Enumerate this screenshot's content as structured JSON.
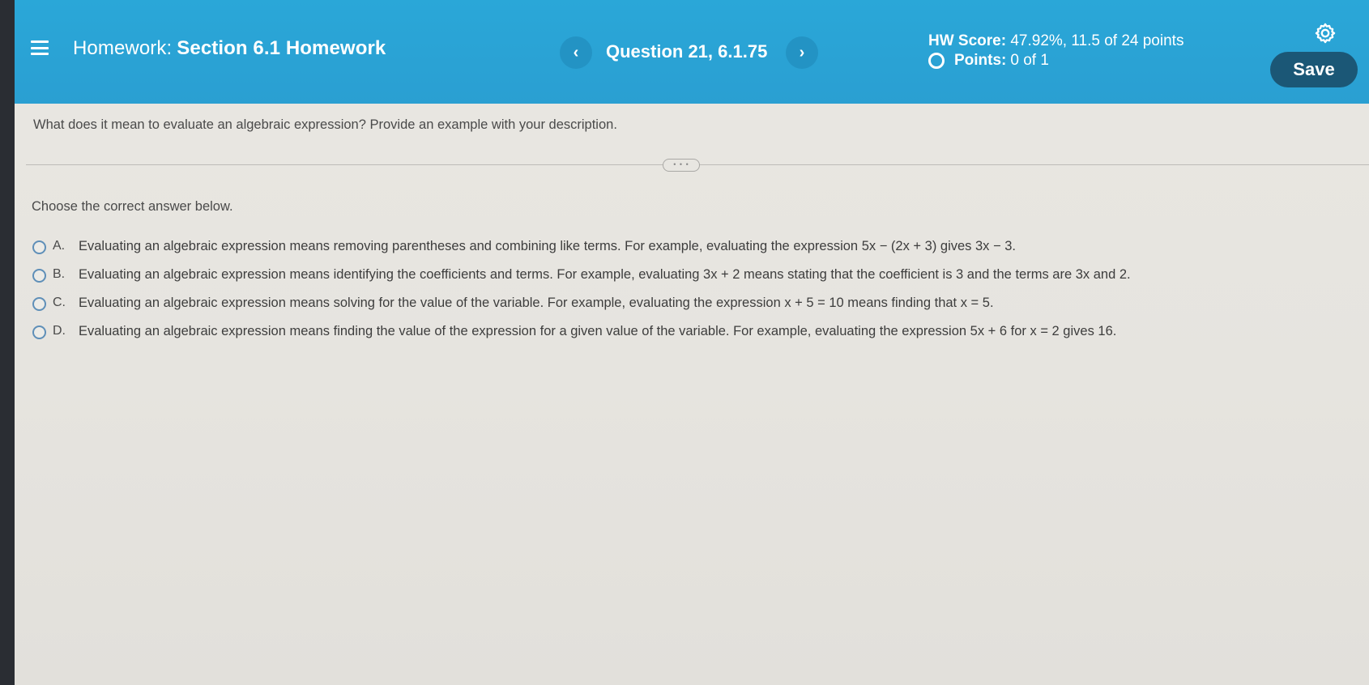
{
  "header": {
    "title_prefix": "Homework:",
    "title_name": "Section 6.1 Homework",
    "prev_label": "‹",
    "next_label": "›",
    "question_label": "Question 21, 6.1.75",
    "hw_score_label": "HW Score:",
    "hw_score_value": "47.92%, 11.5 of 24 points",
    "points_label": "Points:",
    "points_value": "0 of 1",
    "save_label": "Save"
  },
  "question": {
    "text": "What does it mean to evaluate an algebraic expression? Provide an example with your description.",
    "expand_label": "• • •",
    "instruction": "Choose the correct answer below."
  },
  "options": [
    {
      "letter": "A.",
      "text": "Evaluating an algebraic expression means removing parentheses and combining like terms. For example, evaluating the expression 5x − (2x + 3) gives 3x − 3."
    },
    {
      "letter": "B.",
      "text": "Evaluating an algebraic expression means identifying the coefficients and terms. For example, evaluating 3x + 2 means stating that the coefficient is 3 and the terms are 3x and 2."
    },
    {
      "letter": "C.",
      "text": "Evaluating an algebraic expression means solving for the value of the variable. For example, evaluating the expression x + 5 = 10 means finding that x = 5."
    },
    {
      "letter": "D.",
      "text": "Evaluating an algebraic expression means finding the value of the expression for a given value of the variable. For example, evaluating the expression 5x + 6 for x = 2 gives 16."
    }
  ],
  "icons": {
    "menu": "menu-icon",
    "gear": "gear-icon",
    "points_status": "circle-outline-icon"
  },
  "colors": {
    "header_bg": "#2aa7d8",
    "save_button_bg": "#1b5776",
    "radio_border": "#5f8fb8",
    "page_bg": "#e8e6e1"
  }
}
